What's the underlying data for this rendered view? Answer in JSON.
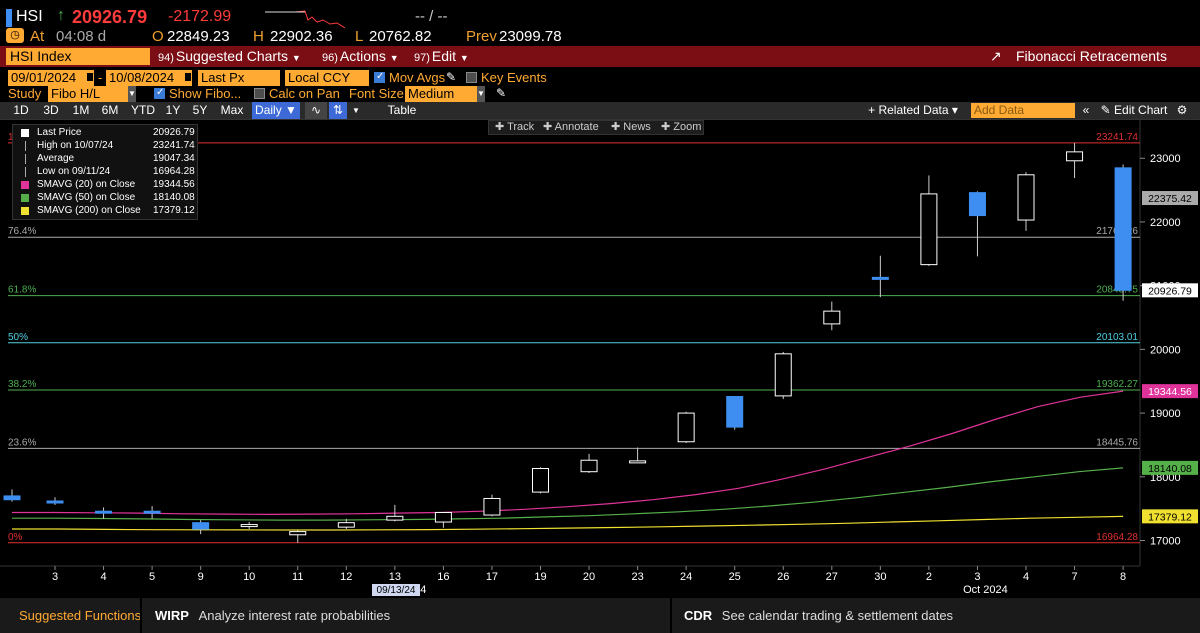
{
  "header": {
    "ticker": "HSI",
    "arrow": "↑",
    "last": "20926.79",
    "change": "-2172.99",
    "spark_range": "-- / --",
    "at_label": "At",
    "time": "04:08 d",
    "open_label": "O",
    "open": "22849.23",
    "high_label": "H",
    "high": "22902.36",
    "low_label": "L",
    "low": "20762.82",
    "prev_label": "Prev",
    "prev": "23099.78"
  },
  "redbar": {
    "security": "HSI Index",
    "suggested_num": "94)",
    "suggested": "Suggested Charts",
    "actions_num": "96)",
    "actions": "Actions",
    "edit_num": "97)",
    "edit": "Edit",
    "study_title": "Fibonacci Retracements"
  },
  "toolbar1": {
    "start_date": "09/01/2024",
    "end_date": "10/08/2024",
    "price_type": "Last Px",
    "currency": "Local CCY",
    "mov_avgs": "Mov Avgs",
    "key_events": "Key Events"
  },
  "toolbar2": {
    "study_label": "Study",
    "study_value": "Fibo H/L",
    "show_fibo": "Show Fibo...",
    "calc_on_pan": "Calc on Pan",
    "font_size_label": "Font Size",
    "font_size": "Medium"
  },
  "periodbar": {
    "periods": [
      "1D",
      "3D",
      "1M",
      "6M",
      "YTD",
      "1Y",
      "5Y",
      "Max"
    ],
    "frequency": "Daily",
    "table": "Table",
    "related": "Related Data",
    "add_data_placeholder": "Add Data",
    "edit_chart": "Edit Chart"
  },
  "chart_tools": {
    "track": "Track",
    "annotate": "Annotate",
    "news": "News",
    "zoom": "Zoom"
  },
  "legend": [
    {
      "label": "Last Price",
      "value": "20926.79",
      "color": "#ffffff",
      "kind": "box"
    },
    {
      "label": "High on 10/07/24",
      "value": "23241.74",
      "color": "#aaaaaa",
      "kind": "high"
    },
    {
      "label": "Average",
      "value": "19047.34",
      "color": "#aaaaaa",
      "kind": "avg"
    },
    {
      "label": "Low on 09/11/24",
      "value": "16964.28",
      "color": "#aaaaaa",
      "kind": "low"
    },
    {
      "label": "SMAVG (20)  on Close",
      "value": "19344.56",
      "color": "#e0339a",
      "kind": "box"
    },
    {
      "label": "SMAVG (50)  on Close",
      "value": "18140.08",
      "color": "#55b04a",
      "kind": "box"
    },
    {
      "label": "SMAVG (200)  on Close",
      "value": "17379.12",
      "color": "#f0e030",
      "kind": "box"
    }
  ],
  "chart_data": {
    "type": "candlestick",
    "ylim": [
      16600,
      23600
    ],
    "yticks": [
      17000,
      18000,
      19000,
      20000,
      21000,
      22000,
      23000
    ],
    "ytick_labels": [
      "17000",
      "18000",
      "19000",
      "20000",
      "21000",
      "22000",
      "23000"
    ],
    "xlabels": [
      "3",
      "4",
      "5",
      "9",
      "10",
      "11",
      "12",
      "13",
      "16",
      "17",
      "19",
      "20",
      "23",
      "24",
      "25",
      "26",
      "27",
      "30",
      "2",
      "3",
      "4",
      "7",
      "8"
    ],
    "month_labels": [
      {
        "label": "Sep 2024",
        "index": 8.3
      },
      {
        "label": "Oct 2024",
        "index": 19.7
      }
    ],
    "cursor_date": "09/13/24",
    "candles": [
      {
        "o": 17700,
        "h": 17800,
        "l": 17610,
        "c": 17640,
        "dir": "down"
      },
      {
        "o": 17620,
        "h": 17680,
        "l": 17560,
        "c": 17610,
        "dir": "down"
      },
      {
        "o": 17460,
        "h": 17520,
        "l": 17340,
        "c": 17450,
        "dir": "down"
      },
      {
        "o": 17460,
        "h": 17540,
        "l": 17340,
        "c": 17440,
        "dir": "down"
      },
      {
        "o": 17280,
        "h": 17320,
        "l": 17100,
        "c": 17180,
        "dir": "down"
      },
      {
        "o": 17220,
        "h": 17290,
        "l": 17180,
        "c": 17250,
        "dir": "up"
      },
      {
        "o": 17090,
        "h": 17160,
        "l": 16964,
        "c": 17140,
        "dir": "up"
      },
      {
        "o": 17210,
        "h": 17340,
        "l": 17180,
        "c": 17280,
        "dir": "up"
      },
      {
        "o": 17320,
        "h": 17560,
        "l": 17300,
        "c": 17380,
        "dir": "up"
      },
      {
        "o": 17290,
        "h": 17420,
        "l": 17200,
        "c": 17440,
        "dir": "up"
      },
      {
        "o": 17400,
        "h": 17720,
        "l": 17380,
        "c": 17660,
        "dir": "up"
      },
      {
        "o": 17760,
        "h": 18150,
        "l": 17740,
        "c": 18130,
        "dir": "up"
      },
      {
        "o": 18080,
        "h": 18360,
        "l": 18060,
        "c": 18260,
        "dir": "up"
      },
      {
        "o": 18240,
        "h": 18460,
        "l": 18230,
        "c": 18250,
        "dir": "up"
      },
      {
        "o": 18550,
        "h": 19020,
        "l": 18530,
        "c": 19000,
        "dir": "up"
      },
      {
        "o": 19260,
        "h": 19260,
        "l": 18740,
        "c": 18780,
        "dir": "down"
      },
      {
        "o": 19270,
        "h": 19960,
        "l": 19220,
        "c": 19930,
        "dir": "up"
      },
      {
        "o": 20400,
        "h": 20750,
        "l": 20300,
        "c": 20600,
        "dir": "up"
      },
      {
        "o": 21130,
        "h": 21470,
        "l": 20820,
        "c": 21100,
        "dir": "down"
      },
      {
        "o": 21330,
        "h": 22730,
        "l": 21310,
        "c": 22440,
        "dir": "up"
      },
      {
        "o": 22460,
        "h": 22480,
        "l": 21460,
        "c": 22100,
        "dir": "down"
      },
      {
        "o": 22030,
        "h": 22780,
        "l": 21860,
        "c": 22740,
        "dir": "up"
      },
      {
        "o": 22960,
        "h": 23241.74,
        "l": 22690,
        "c": 23100,
        "dir": "up"
      },
      {
        "o": 22849.23,
        "h": 22902.36,
        "l": 20762.82,
        "c": 20926.79,
        "dir": "down"
      }
    ],
    "sma20": [
      17440,
      17440,
      17435,
      17430,
      17420,
      17415,
      17410,
      17415,
      17420,
      17430,
      17440,
      17460,
      17490,
      17530,
      17580,
      17640,
      17720,
      17820,
      17960,
      18120,
      18300,
      18480,
      18680,
      18900,
      19100,
      19250,
      19344.56
    ],
    "sma50": [
      17350,
      17350,
      17345,
      17340,
      17330,
      17325,
      17320,
      17320,
      17325,
      17330,
      17340,
      17350,
      17370,
      17390,
      17420,
      17450,
      17490,
      17540,
      17600,
      17670,
      17750,
      17830,
      17920,
      18000,
      18080,
      18140.08
    ],
    "sma200": [
      17180,
      17180,
      17175,
      17170,
      17168,
      17166,
      17165,
      17165,
      17168,
      17172,
      17178,
      17185,
      17195,
      17205,
      17215,
      17228,
      17240,
      17255,
      17270,
      17290,
      17310,
      17330,
      17350,
      17365,
      17379.12
    ],
    "fib_levels": [
      {
        "pct": "100%",
        "value": 23241.74,
        "label": "23241.74",
        "color": "#e03030"
      },
      {
        "pct": "76.4%",
        "value": 21760.26,
        "label": "21760.26",
        "color": "#aaaaaa"
      },
      {
        "pct": "61.8%",
        "value": 20843.75,
        "label": "20843.75",
        "color": "#4caf50"
      },
      {
        "pct": "50%",
        "value": 20103.01,
        "label": "20103.01",
        "color": "#4fd0e0"
      },
      {
        "pct": "38.2%",
        "value": 19362.27,
        "label": "19362.27",
        "color": "#4caf50"
      },
      {
        "pct": "23.6%",
        "value": 18445.76,
        "label": "18445.76",
        "color": "#aaaaaa"
      },
      {
        "pct": "0%",
        "value": 16964.28,
        "label": "16964.28",
        "color": "#e03030"
      }
    ],
    "right_tags": [
      {
        "value": 22375.42,
        "label": "22375.42",
        "bg": "#aaaaaa",
        "fg": "#000000"
      },
      {
        "value": 20926.79,
        "label": "20926.79",
        "bg": "#ffffff",
        "fg": "#000000"
      },
      {
        "value": 19344.56,
        "label": "19344.56",
        "bg": "#e0339a",
        "fg": "#ffffff"
      },
      {
        "value": 18140.08,
        "label": "18140.08",
        "bg": "#55b04a",
        "fg": "#000000"
      },
      {
        "value": 17379.12,
        "label": "17379.12",
        "bg": "#f0e030",
        "fg": "#000000"
      }
    ]
  },
  "bottom": {
    "suggested": "Suggested Functions",
    "f1_code": "WIRP",
    "f1_desc": "Analyze interest rate probabilities",
    "f2_code": "CDR",
    "f2_desc": "See calendar trading & settlement dates"
  }
}
